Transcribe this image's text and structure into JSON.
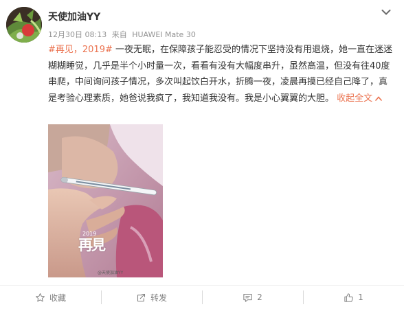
{
  "user": {
    "name": "天使加油YY",
    "date": "12月30日 08:13",
    "source_prefix": "来自",
    "device": "HUAWEI Mate 30"
  },
  "post": {
    "hashtag": "#再见，2019#",
    "text": " 一夜无眠，在保障孩子能忍受的情况下坚持没有用退烧，她一直在迷迷糊糊睡觉，几乎是半个小时量一次，看看有没有大幅度串升，虽然高温，但没有往40度串爬，中间询问孩子情况，多次叫起饮白开水，折腾一夜，凌晨再摸已经自己降了，真是考验心理素质，她爸说我疯了，我知道我没有。我是小心翼翼的大胆。 ",
    "collapse_label": "收起全文"
  },
  "photo": {
    "watermark_year": "2019",
    "watermark_text": "再見",
    "watermark_small": "@天使加油YY"
  },
  "actions": {
    "favorite_label": "收藏",
    "repost_label": "转发",
    "comment_count": "2",
    "like_count": "1"
  },
  "colors": {
    "accent": "#eb7350",
    "meta": "#939393",
    "action": "#808080"
  }
}
